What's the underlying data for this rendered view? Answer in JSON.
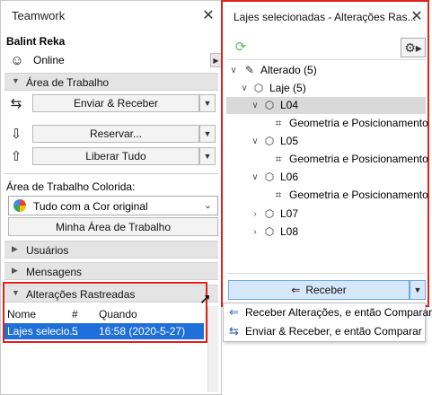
{
  "left": {
    "title": "Teamwork",
    "user": "Balint Reka",
    "status": "Online",
    "workspace_section": "Área de Trabalho",
    "send_receive": "Enviar & Receber",
    "reserve": "Reservar...",
    "release_all": "Liberar Tudo",
    "colored_label": "Área de Trabalho Colorida:",
    "color_mode": "Tudo com a Cor original",
    "my_workspace": "Minha Área de Trabalho",
    "users_section": "Usuários",
    "messages_section": "Mensagens",
    "tracked_section": "Alterações Rastreadas",
    "table": {
      "headers": [
        "Nome",
        "#",
        "Quando"
      ],
      "rows": [
        {
          "name": "Lajes selecio...",
          "count": "5",
          "when": "16:58 (2020-5-27)"
        }
      ]
    }
  },
  "right": {
    "title": "Lajes selecionadas - Alterações Ras...",
    "tree": {
      "altered": "Alterado (5)",
      "slab": "Laje (5)",
      "l04": "L04",
      "l04_child": "Geometria e Posicionamento",
      "l05": "L05",
      "l05_child": "Geometria e Posicionamento",
      "l06": "L06",
      "l06_child": "Geometria e Posicionamento",
      "l07": "L07",
      "l08": "L08"
    },
    "receive": "Receber",
    "menu": {
      "receive_compare": "Receber Alterações, e então Comparar",
      "send_receive_compare": "Enviar & Receber, e então Comparar"
    }
  },
  "colors": {
    "highlight": "#e0201a",
    "selection": "#1e6fd9",
    "receive_button": "#d5e8fa"
  }
}
